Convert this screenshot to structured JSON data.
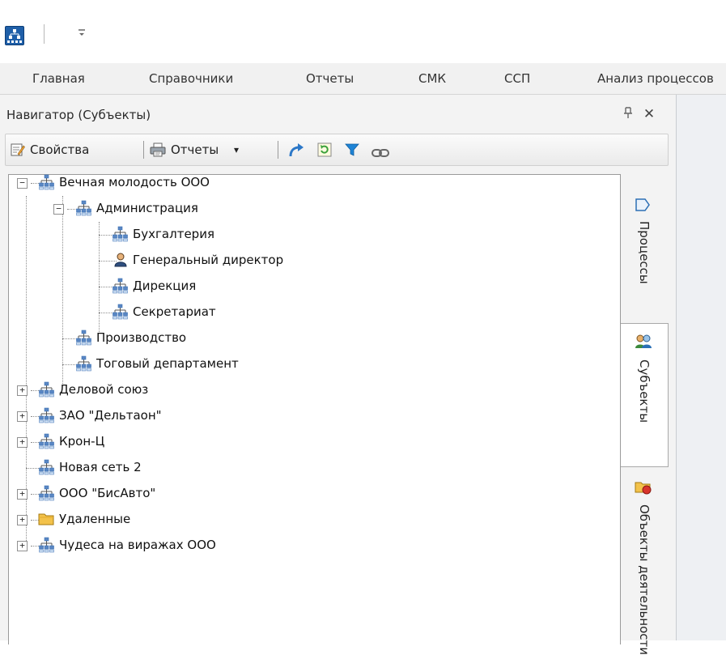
{
  "quick_access": {
    "dropdown_glyph": "⩸"
  },
  "ribbon": {
    "tabs": [
      "Главная",
      "Справочники",
      "Отчеты",
      "СМК",
      "ССП",
      "Анализ процессов"
    ]
  },
  "navigator": {
    "title": "Навигатор (Субъекты)",
    "pin_glyph": "⊥",
    "close_glyph": "✕",
    "toolbar": {
      "properties_label": "Свойства",
      "reports_label": "Отчеты",
      "reports_arrow": "▾"
    }
  },
  "tree": {
    "nodes": [
      {
        "label": "Вечная молодость ООО",
        "expander": "−",
        "icon": "org-structure-icon"
      },
      {
        "label": "Администрация",
        "expander": "−",
        "icon": "org-structure-icon"
      },
      {
        "label": "Бухгалтерия",
        "icon": "org-structure-icon"
      },
      {
        "label": "Генеральный директор",
        "icon": "person-icon"
      },
      {
        "label": "Дирекция",
        "icon": "org-structure-icon"
      },
      {
        "label": "Секретариат",
        "icon": "org-structure-icon"
      },
      {
        "label": "Производство",
        "icon": "org-structure-icon"
      },
      {
        "label": "Тоговый департамент",
        "icon": "org-structure-icon"
      },
      {
        "label": "Деловой союз",
        "expander": "+",
        "icon": "org-structure-icon"
      },
      {
        "label": "ЗАО \"Дельтаон\"",
        "expander": "+",
        "icon": "org-structure-icon"
      },
      {
        "label": "Крон-Ц",
        "expander": "+",
        "icon": "org-structure-icon"
      },
      {
        "label": "Новая сеть 2",
        "icon": "org-structure-icon"
      },
      {
        "label": "ООО \"БисАвто\"",
        "expander": "+",
        "icon": "org-structure-icon"
      },
      {
        "label": "Удаленные",
        "expander": "+",
        "icon": "folder-icon"
      },
      {
        "label": "Чудеса на виражах ООО",
        "expander": "+",
        "icon": "org-structure-icon"
      }
    ]
  },
  "side_tabs": [
    {
      "label": "Процессы",
      "icon": "process-icon",
      "active": false
    },
    {
      "label": "Субъекты",
      "icon": "people-icon",
      "active": true
    },
    {
      "label": "Объекты деятельности",
      "icon": "objects-icon",
      "active": false
    }
  ],
  "colors": {
    "org_icon": "#5a87c4",
    "org_icon_dark": "#3a6fb3",
    "folder": "#f3c24a",
    "filter": "#1e84d6",
    "refresh": "#3aa13a",
    "arrow": "#2c78c8"
  }
}
